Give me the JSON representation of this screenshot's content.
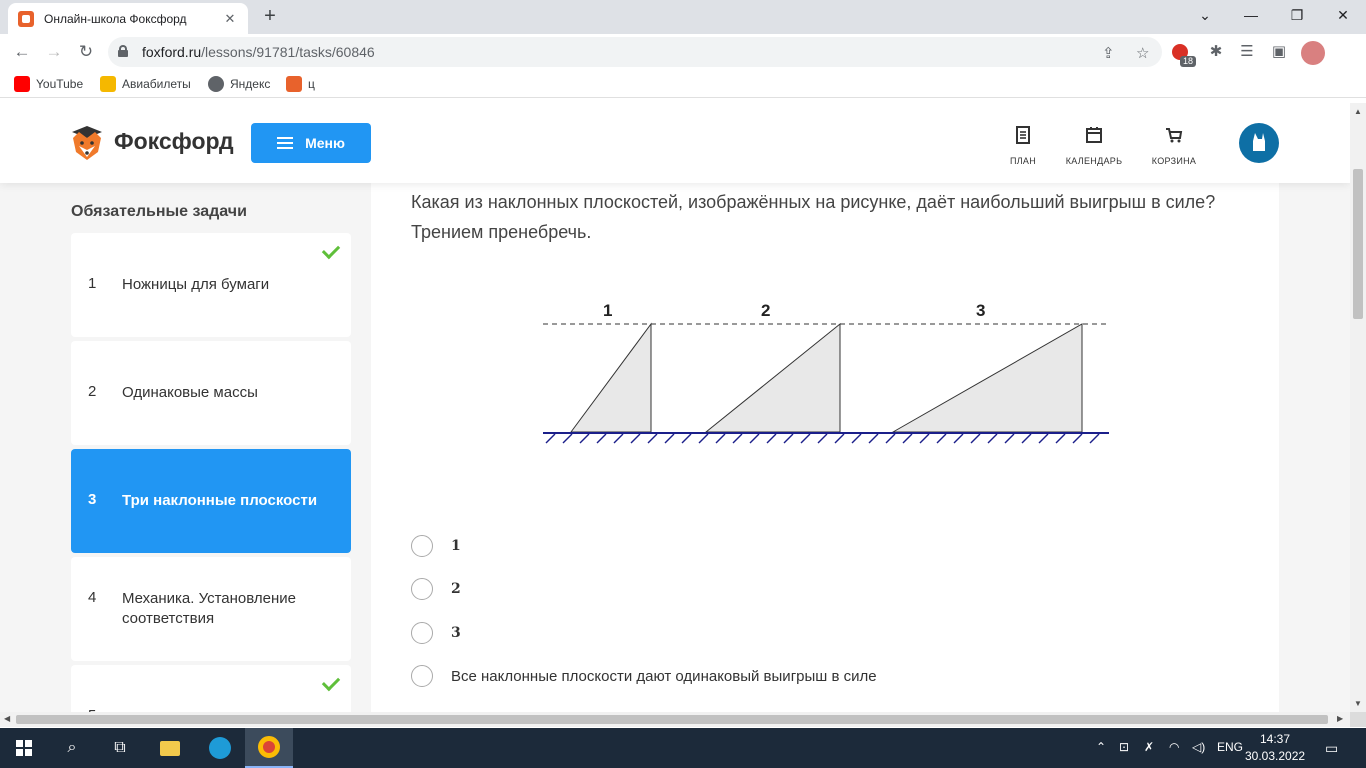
{
  "browser": {
    "tab_title": "Онлайн-школа Фоксфорд",
    "tab_close": "✕",
    "new_tab": "+",
    "url_host": "foxford.ru",
    "url_path": "/lessons/91781/tasks/60846",
    "ext_badge_count": "18",
    "window_controls": {
      "minimize": "—",
      "maximize": "❐",
      "close": "✕",
      "tab_search": "⌄"
    },
    "bookmarks": [
      {
        "label": "YouTube",
        "color": "#ff0000"
      },
      {
        "label": "Авиабилеты",
        "color": "#f5b800"
      },
      {
        "label": "Яндекс",
        "color": "#5f6368"
      },
      {
        "label": "ц",
        "color": "#e8622c"
      }
    ]
  },
  "header": {
    "logo_text": "Фоксфорд",
    "menu_label": "Меню",
    "nav": [
      {
        "label": "ПЛАН",
        "icon": "plan-icon"
      },
      {
        "label": "КАЛЕНДАРЬ",
        "icon": "calendar-icon"
      },
      {
        "label": "КОРЗИНА",
        "icon": "cart-icon"
      }
    ],
    "brand_color": "#2196f3"
  },
  "sidebar": {
    "title": "Обязательные задачи",
    "tasks": [
      {
        "num": "1",
        "label": "Ножницы для бумаги",
        "done": true
      },
      {
        "num": "2",
        "label": "Одинаковые массы",
        "done": false
      },
      {
        "num": "3",
        "label": "Три наклонные плоскости",
        "active": true
      },
      {
        "num": "4",
        "label": "Механика. Установление соответствия",
        "done": false
      },
      {
        "num": "5",
        "label": "",
        "done": true
      }
    ]
  },
  "question": {
    "text": "Какая из наклонных плоскостей, изображённых на рисунке, даёт наибольший выигрыш в силе? Трением пренебречь.",
    "figure_labels": [
      "1",
      "2",
      "3"
    ],
    "answers": [
      "1",
      "2",
      "3",
      "Все наклонные плоскости дают одинаковый выигрыш в силе"
    ]
  },
  "taskbar": {
    "lang": "ENG",
    "time": "14:37",
    "date": "30.03.2022"
  }
}
